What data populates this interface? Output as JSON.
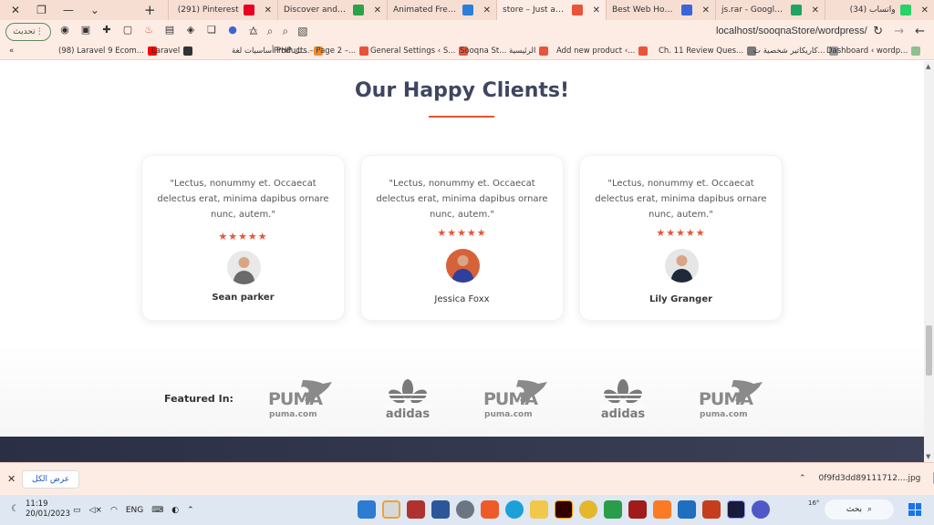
{
  "browser": {
    "tabs": [
      {
        "title": "واتساب (34)",
        "favicon_color": "#25d366",
        "active": false
      },
      {
        "title": "js.rar - Google Drive",
        "favicon_color": "#1fa463",
        "active": false
      },
      {
        "title": "Best Web Hosting - D",
        "favicon_color": "#3b64d8",
        "active": false
      },
      {
        "title": "store – Just another W",
        "favicon_color": "#e8543a",
        "active": true
      },
      {
        "title": "Animated Free 3D Mo",
        "favicon_color": "#2b7fd8",
        "active": false
      },
      {
        "title": "Discover and downlo",
        "favicon_color": "#2ca24a",
        "active": false
      },
      {
        "title": "(291) Pinterest",
        "favicon_color": "#e60023",
        "active": false
      }
    ],
    "update_label": "تحديث",
    "url": "localhost/sooqnaStore/wordpress/",
    "bookmarks": [
      {
        "label": "«",
        "color": "#fdece4"
      },
      {
        "label": "(98) Laravel 9 Ecom...",
        "color": "#ff0000"
      },
      {
        "label": "Laravel",
        "color": "#333333"
      },
      {
        "label": "أساسيات لغة PHP لل...",
        "color": "#f28b2e"
      },
      {
        "label": "Products – Page 2 –...",
        "color": "#e8543a"
      },
      {
        "label": "General Settings ‹ S...",
        "color": "#e8543a"
      },
      {
        "label": "Sooqna St... الرئيسية",
        "color": "#e8543a"
      },
      {
        "label": "Add new product ‹...",
        "color": "#e8543a"
      },
      {
        "label": "Ch. 11 Review Ques...",
        "color": "#777777"
      },
      {
        "label": "كاريكاتير شخصية ت...",
        "color": "#999999"
      },
      {
        "label": "Dashboard ‹ wordp...",
        "color": "#8fbf8f"
      }
    ]
  },
  "section": {
    "title": "Our Happy Clients!"
  },
  "testimonials": [
    {
      "quote": "\"Lectus, nonummy et. Occaecat delectus erat, minima dapibus ornare nunc, autem.\"",
      "stars": "★★★★★",
      "name": "Sean parker",
      "bold": true,
      "avatar_bg": "#e9e9e9",
      "avatar_fg": "#6a6a6a"
    },
    {
      "quote": "\"Lectus, nonummy et. Occaecat delectus erat, minima dapibus ornare nunc, autem.\"",
      "stars": "★★★★★",
      "name": "Jessica Foxx",
      "bold": false,
      "avatar_bg": "#d6623a",
      "avatar_fg": "#2e3f9e"
    },
    {
      "quote": "\"Lectus, nonummy et. Occaecat delectus erat, minima dapibus ornare nunc, autem.\"",
      "stars": "★★★★★",
      "name": "Lily Granger",
      "bold": true,
      "avatar_bg": "#e6e6e6",
      "avatar_fg": "#1e2a3a"
    }
  ],
  "featured": {
    "label": "Featured In:",
    "logos": [
      {
        "brand": "puma",
        "text": "PUMA",
        "sub": "puma.com"
      },
      {
        "brand": "adidas",
        "text": "adidas"
      },
      {
        "brand": "puma",
        "text": "PUMA",
        "sub": "puma.com"
      },
      {
        "brand": "adidas",
        "text": "adidas"
      },
      {
        "brand": "puma",
        "text": "PUMA",
        "sub": "puma.com"
      }
    ]
  },
  "download_bar": {
    "show_all": "عرض الكل",
    "filename": "0f9fd3dd89111712....jpg"
  },
  "taskbar": {
    "time": "11:19",
    "date": "20/01/2023",
    "lang": "ENG",
    "search": "بحث",
    "weather": "16°"
  }
}
